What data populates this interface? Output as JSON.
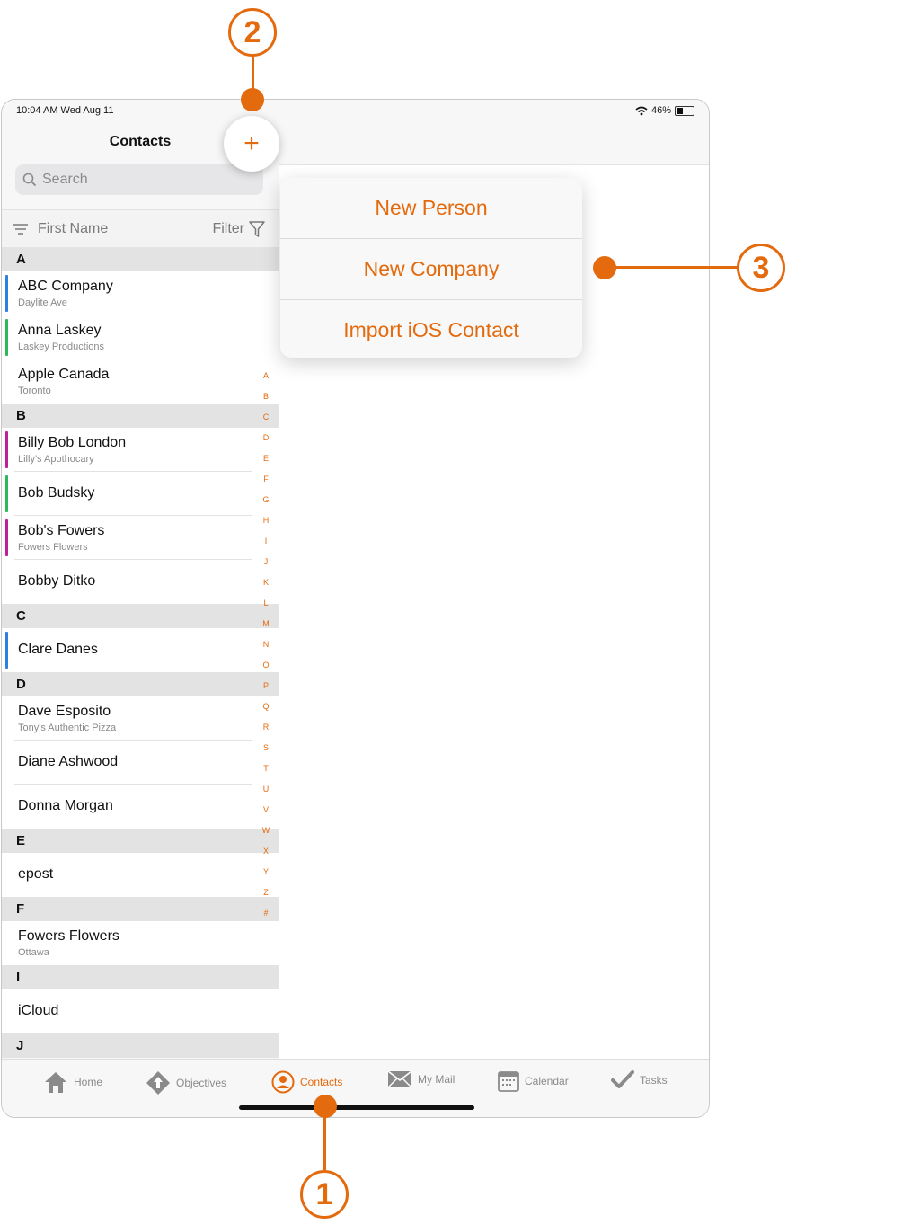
{
  "status": {
    "time": "10:04 AM   Wed Aug 11",
    "battery": "46%"
  },
  "nav": {
    "title": "Contacts",
    "add_label": "+"
  },
  "search": {
    "placeholder": "Search"
  },
  "sort": {
    "field": "First Name",
    "filter_label": "Filter"
  },
  "sections": [
    {
      "letter": "A",
      "rows": [
        {
          "name": "ABC Company",
          "sub": "Daylite Ave",
          "bar": "#2f7fe0"
        },
        {
          "name": "Anna Laskey",
          "sub": "Laskey Productions",
          "bar": "#2db85a"
        },
        {
          "name": "Apple Canada",
          "sub": "Toronto",
          "bar": ""
        }
      ]
    },
    {
      "letter": "B",
      "rows": [
        {
          "name": "Billy Bob London",
          "sub": "Lilly's Apothocary",
          "bar": "#c21e9a"
        },
        {
          "name": "Bob Budsky",
          "sub": "",
          "bar": "#2db85a"
        },
        {
          "name": "Bob's Fowers",
          "sub": "Fowers Flowers",
          "bar": "#c21e9a"
        },
        {
          "name": "Bobby Ditko",
          "sub": "",
          "bar": ""
        }
      ]
    },
    {
      "letter": "C",
      "rows": [
        {
          "name": "Clare Danes",
          "sub": "",
          "bar": "#2f7fe0"
        }
      ]
    },
    {
      "letter": "D",
      "rows": [
        {
          "name": "Dave Esposito",
          "sub": "Tony's Authentic Pizza",
          "bar": ""
        },
        {
          "name": "Diane Ashwood",
          "sub": "",
          "bar": ""
        },
        {
          "name": "Donna Morgan",
          "sub": "",
          "bar": ""
        }
      ]
    },
    {
      "letter": "E",
      "rows": [
        {
          "name": "epost",
          "sub": "",
          "bar": ""
        }
      ]
    },
    {
      "letter": "F",
      "rows": [
        {
          "name": "Fowers Flowers",
          "sub": "Ottawa",
          "bar": ""
        }
      ]
    },
    {
      "letter": "I",
      "rows": [
        {
          "name": "iCloud",
          "sub": "",
          "bar": ""
        }
      ]
    },
    {
      "letter": "J",
      "rows": []
    }
  ],
  "index_letters": [
    "A",
    "B",
    "C",
    "D",
    "E",
    "F",
    "G",
    "H",
    "I",
    "J",
    "K",
    "L",
    "M",
    "N",
    "O",
    "P",
    "Q",
    "R",
    "S",
    "T",
    "U",
    "V",
    "W",
    "X",
    "Y",
    "Z",
    "#"
  ],
  "popover": {
    "items": [
      "New Person",
      "New Company",
      "Import iOS Contact"
    ]
  },
  "tabs": [
    {
      "label": "Home",
      "icon": "home-icon",
      "active": false
    },
    {
      "label": "Objectives",
      "icon": "objectives-icon",
      "active": false
    },
    {
      "label": "Contacts",
      "icon": "contacts-icon",
      "active": true
    },
    {
      "label": "My Mail",
      "icon": "mail-icon",
      "active": false
    },
    {
      "label": "Calendar",
      "icon": "calendar-icon",
      "active": false
    },
    {
      "label": "Tasks",
      "icon": "tasks-icon",
      "active": false
    }
  ],
  "callouts": [
    "1",
    "2",
    "3"
  ],
  "colors": {
    "accent": "#e46a0e"
  }
}
